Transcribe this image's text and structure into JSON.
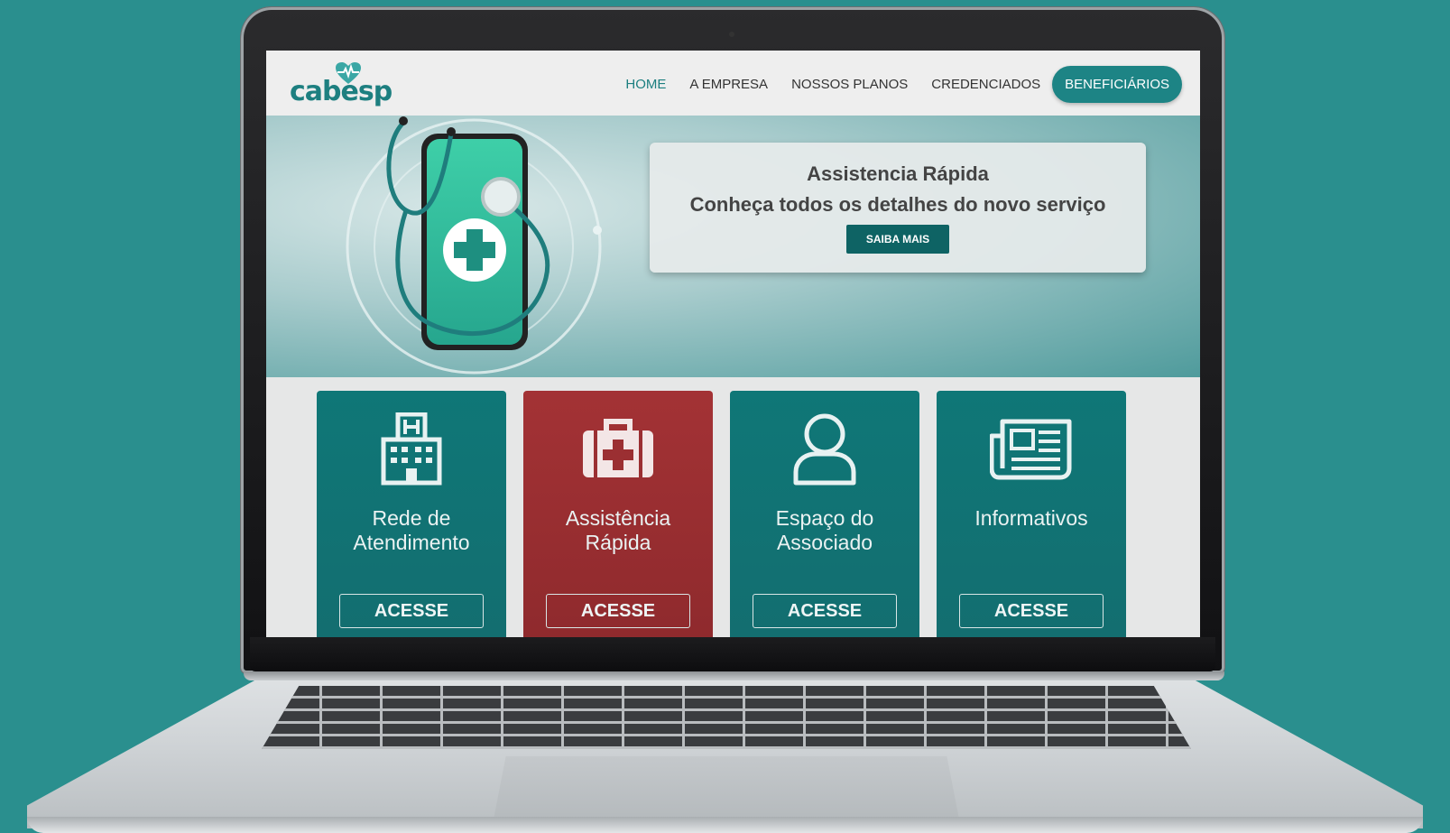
{
  "logo": {
    "text": "cabesp"
  },
  "nav": {
    "items": [
      {
        "label": "HOME"
      },
      {
        "label": "A EMPRESA"
      },
      {
        "label": "NOSSOS PLANOS"
      },
      {
        "label": "CREDENCIADOS"
      }
    ],
    "cta_label": "BENEFICIÁRIOS"
  },
  "hero": {
    "title": "Assistencia Rápida",
    "subtitle": "Conheça todos os detalhes do novo serviço",
    "button_label": "SAIBA MAIS"
  },
  "cards": [
    {
      "title_line1": "Rede de",
      "title_line2": "Atendimento",
      "button_label": "ACESSE",
      "icon": "hospital-icon",
      "color": "#127373"
    },
    {
      "title_line1": "Assistência",
      "title_line2": "Rápida",
      "button_label": "ACESSE",
      "icon": "medical-kit-icon",
      "color": "#9b2f32"
    },
    {
      "title_line1": "Espaço do",
      "title_line2": "Associado",
      "button_label": "ACESSE",
      "icon": "user-icon",
      "color": "#127373"
    },
    {
      "title_line1": "Informativos",
      "title_line2": "",
      "button_label": "ACESSE",
      "icon": "newspaper-icon",
      "color": "#127373"
    }
  ],
  "colors": {
    "brand": "#1d8485",
    "background": "#2a8f8e",
    "accent_red": "#9b2f32"
  }
}
